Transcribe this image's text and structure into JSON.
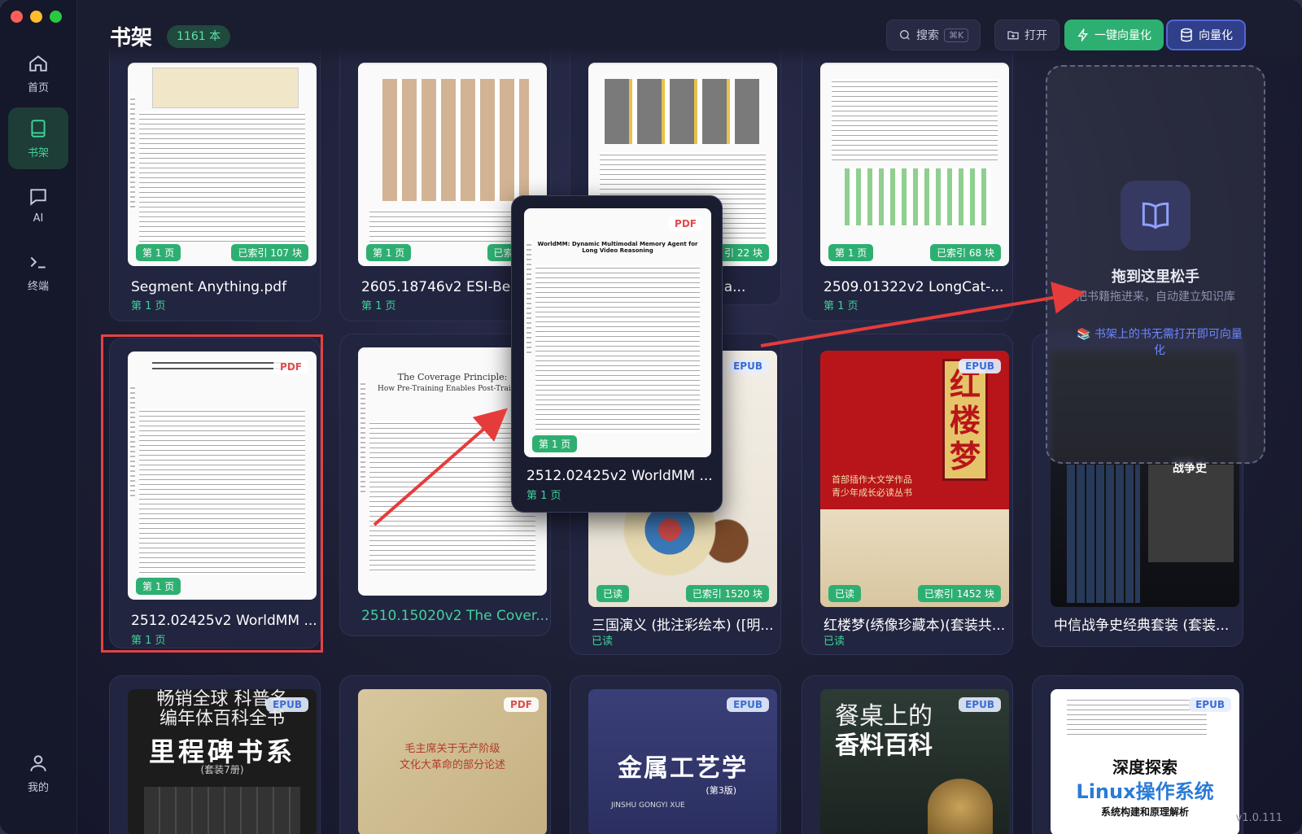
{
  "header": {
    "title": "书架",
    "count": "1161 本",
    "search_label": "搜索",
    "search_shortcut": "⌘K",
    "open_label": "打开",
    "quick_vector_label": "一键向量化",
    "vector_label": "向量化"
  },
  "sidebar": {
    "items": [
      {
        "label": "首页"
      },
      {
        "label": "书架"
      },
      {
        "label": "AI"
      },
      {
        "label": "终端"
      },
      {
        "label": "我的"
      }
    ]
  },
  "books": [
    {
      "title": "Segment Anything.pdf",
      "sub": "第 1 页",
      "page": "第 1 页",
      "index": "已索引 107 块"
    },
    {
      "title": "2605.18746v2 ESI-Ben",
      "sub": "第 1 页",
      "page": "第 1 页",
      "index": "已索引 7"
    },
    {
      "title": "ctNa...",
      "index": "引 22 块"
    },
    {
      "title": "2509.01322v2 LongCat-...",
      "sub": "第 1 页",
      "page": "第 1 页",
      "index": "已索引 68 块"
    },
    {
      "title": "2512.02425v2 WorldMM ...",
      "sub": "第 1 页",
      "type": "PDF",
      "page": "第 1 页"
    },
    {
      "title": "2510.15020v2 The Cover..."
    },
    {
      "title": "三国演义 (批注彩绘本) ([明...",
      "sub": "已读",
      "type": "EPUB",
      "read": "已读",
      "index": "已索引 1520 块"
    },
    {
      "title": "红楼梦(绣像珍藏本)(套装共...",
      "sub": "已读",
      "type": "EPUB",
      "read": "已读",
      "index": "已索引 1452 块"
    },
    {
      "title": "中信战争史经典套装 (套装..."
    }
  ],
  "row3": [
    {
      "type": "EPUB",
      "line1": "畅销全球 科普名",
      "line2": "编年体百科全书",
      "line3": "里程碑书系",
      "line4": "(套装7册)"
    },
    {
      "type": "PDF",
      "line1": "毛主席关于无产阶级",
      "line2": "文化大革命的部分论述"
    },
    {
      "type": "EPUB",
      "line1": "金属工艺学",
      "line2": "(第3版)",
      "line3": "JINSHU GONGYI XUE"
    },
    {
      "type": "EPUB",
      "line1": "餐桌上的",
      "line2": "香料百科"
    },
    {
      "type": "EPUB",
      "line1": "深度探索",
      "line2": "Linux操作系统",
      "line3": "系统构建和原理解析"
    }
  ],
  "drag_card": {
    "title": "2512.02425v2 WorldMM ...",
    "sub": "第 1 页",
    "type": "PDF",
    "page": "第 1 页",
    "paper_title": "WorldMM: Dynamic Multimodal Memory Agent for Long Video Reasoning"
  },
  "drop_zone": {
    "title": "拖到这里松手",
    "subtitle": "把书籍拖进来，自动建立知识库",
    "tip": "书架上的书无需打开即可向量化"
  },
  "hongloumeng": {
    "title": "红楼梦",
    "tag1": "首部插作大文学作品",
    "tag2": "青少年成长必读丛书"
  },
  "war_cover": {
    "title": "战争史"
  },
  "coverage": {
    "title": "The Coverage Principle:",
    "subtitle": "How Pre-Training Enables Post-Training"
  },
  "version": "v1.0.111",
  "colors": {
    "accent": "#2eaf72",
    "vector": "#5466d6",
    "highlight": "#e44343"
  }
}
